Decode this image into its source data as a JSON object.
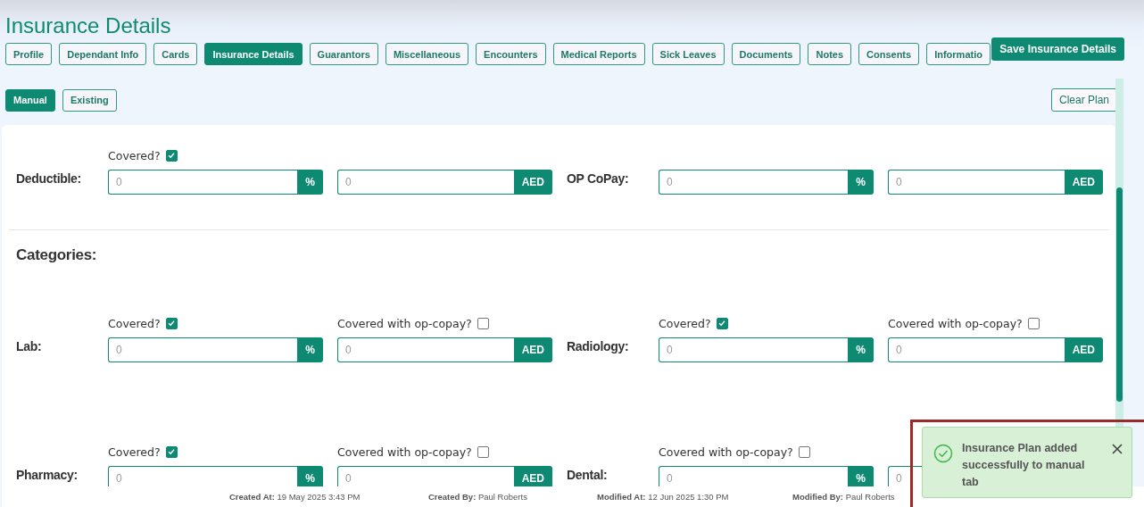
{
  "page_title": "Insurance Details",
  "tabs": [
    {
      "label": "Profile",
      "selected": false
    },
    {
      "label": "Dependant Info",
      "selected": false
    },
    {
      "label": "Cards",
      "selected": false
    },
    {
      "label": "Insurance Details",
      "selected": true
    },
    {
      "label": "Guarantors",
      "selected": false
    },
    {
      "label": "Miscellaneous",
      "selected": false
    },
    {
      "label": "Encounters",
      "selected": false
    },
    {
      "label": "Medical Reports",
      "selected": false
    },
    {
      "label": "Sick Leaves",
      "selected": false
    },
    {
      "label": "Documents",
      "selected": false
    },
    {
      "label": "Notes",
      "selected": false
    },
    {
      "label": "Consents",
      "selected": false
    },
    {
      "label": "Informatio",
      "selected": false
    }
  ],
  "save_button": "Save Insurance Details",
  "plan_tabs": [
    {
      "label": "Manual",
      "selected": true
    },
    {
      "label": "Existing",
      "selected": false
    }
  ],
  "clear_button": "Clear Plan",
  "top_rows": [
    [
      {
        "label": "Deductible:",
        "fields": [
          {
            "check": {
              "label": "Covered?",
              "checked": true
            },
            "placeholder": "0",
            "unit": "%"
          },
          {
            "placeholder": "0",
            "unit": "AED"
          }
        ]
      },
      {
        "label": "OP CoPay:",
        "fields": [
          {
            "placeholder": "0",
            "unit": "%"
          },
          {
            "placeholder": "0",
            "unit": "AED"
          }
        ]
      }
    ]
  ],
  "categories_heading": "Categories:",
  "category_rows": [
    [
      {
        "label": "Lab:",
        "fields": [
          {
            "check": {
              "label": "Covered?",
              "checked": true
            },
            "placeholder": "0",
            "unit": "%"
          },
          {
            "check": {
              "label": "Covered with op-copay?",
              "checked": false
            },
            "placeholder": "0",
            "unit": "AED"
          }
        ]
      },
      {
        "label": "Radiology:",
        "fields": [
          {
            "check": {
              "label": "Covered?",
              "checked": true
            },
            "placeholder": "0",
            "unit": "%"
          },
          {
            "check": {
              "label": "Covered with op-copay?",
              "checked": false
            },
            "placeholder": "0",
            "unit": "AED"
          }
        ]
      }
    ],
    [
      {
        "label": "Pharmacy:",
        "fields": [
          {
            "check": {
              "label": "Covered?",
              "checked": true
            },
            "placeholder": "0",
            "unit": "%"
          },
          {
            "check": {
              "label": "Covered with op-copay?",
              "checked": false
            },
            "placeholder": "0",
            "unit": "AED"
          }
        ]
      },
      {
        "label": "Dental:",
        "fields": [
          {
            "check": {
              "label": "Covered with op-copay?",
              "checked": false
            },
            "placeholder": "0",
            "unit": "%"
          },
          {
            "placeholder": "0"
          }
        ]
      }
    ]
  ],
  "footer": [
    "**Created At:** 19 May 2025 3:43 PM",
    "**Created By:** Paul Roberts",
    "**Modified At:** 12 Jun 2025 1:30 PM",
    "**Modified By:** Paul Roberts"
  ],
  "toast": {
    "kind": "success",
    "message": "Insurance Plan added successfully to manual tab"
  }
}
